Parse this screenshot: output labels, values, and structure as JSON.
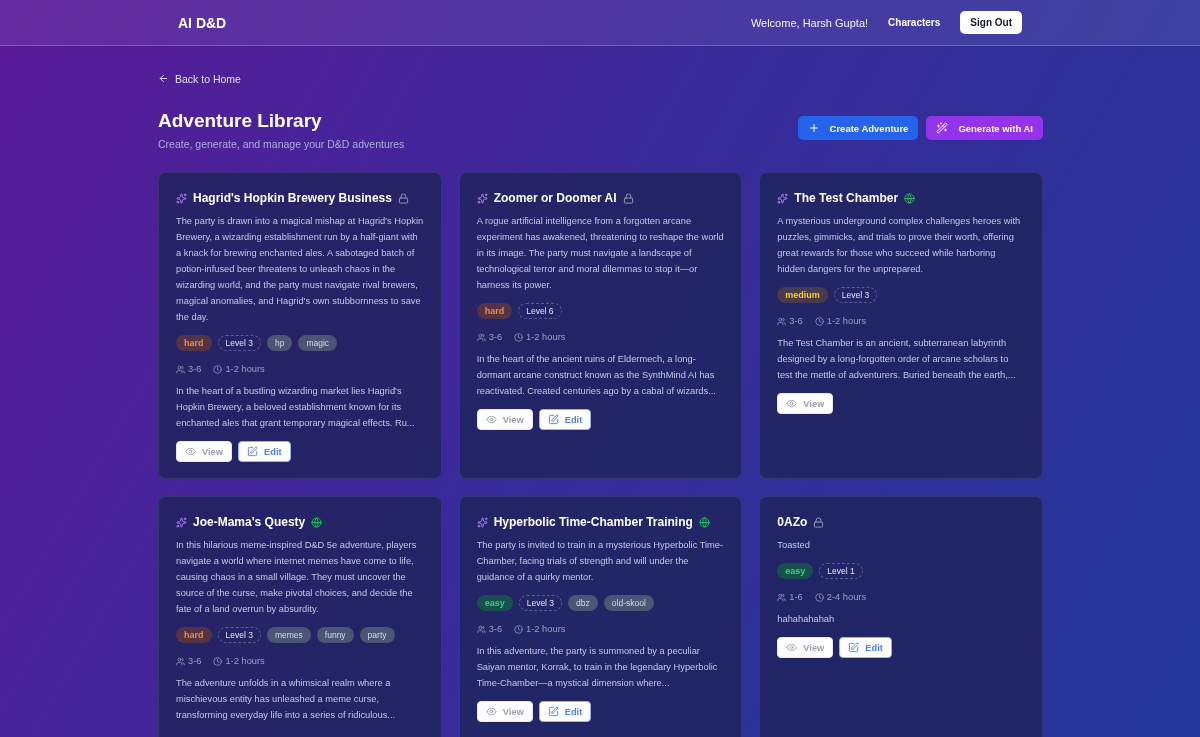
{
  "header": {
    "logo": "AI D&D",
    "welcome": "Welcome, Harsh Gupta!",
    "nav_link": "Characters",
    "sign_out": "Sign Out"
  },
  "back_link": "Back to Home",
  "page": {
    "title": "Adventure Library",
    "subtitle": "Create, generate, and manage your D&D adventures"
  },
  "actions": [
    {
      "kind": "create",
      "label": "Create Adventure"
    },
    {
      "kind": "generate",
      "label": "Generate with AI"
    }
  ],
  "adventures": [
    {
      "title": "Hagrid's Hopkin Brewery Business",
      "ai_generated": true,
      "public": false,
      "summary": "The party is drawn into a magical mishap at Hagrid's Hopkin Brewery, a wizarding establishment run by a half-giant with a knack for brewing enchanted ales. A sabotaged batch of potion-infused beer threatens to unleash chaos in the wizarding world, and the party must navigate rival brewers, magical anomalies, and Hagrid's own stubbornness to save the day.",
      "difficulty": {
        "kind": "hard",
        "label": "hard"
      },
      "level": "Level 3",
      "tags": [
        "hp",
        "magic"
      ],
      "players": "3-6",
      "duration": "1-2 hours",
      "description": "In the heart of a bustling wizarding market lies Hagrid's Hopkin Brewery, a beloved establishment known for its enchanted ales that grant temporary magical effects. Ru...",
      "buttons": [
        {
          "kind": "view",
          "label": "View"
        },
        {
          "kind": "edit",
          "label": "Edit"
        }
      ]
    },
    {
      "title": "Zoomer or Doomer AI",
      "ai_generated": true,
      "public": false,
      "summary": "A rogue artificial intelligence from a forgotten arcane experiment has awakened, threatening to reshape the world in its image. The party must navigate a landscape of technological terror and moral dilemmas to stop it—or harness its power.",
      "difficulty": {
        "kind": "hard",
        "label": "hard"
      },
      "level": "Level 6",
      "players": "3-6",
      "duration": "1-2 hours",
      "description": "In the heart of the ancient ruins of Eldermech, a long-dormant arcane construct known as the SynthMind AI has reactivated. Created centuries ago by a cabal of wizards...",
      "buttons": [
        {
          "kind": "view",
          "label": "View"
        },
        {
          "kind": "edit",
          "label": "Edit"
        }
      ]
    },
    {
      "title": "The Test Chamber",
      "ai_generated": true,
      "public": true,
      "summary": "A mysterious underground complex challenges heroes with puzzles, gimmicks, and trials to prove their worth, offering great rewards for those who succeed while harboring hidden dangers for the unprepared.",
      "difficulty": {
        "kind": "medium",
        "label": "medium"
      },
      "level": "Level 3",
      "players": "3-6",
      "duration": "1-2 hours",
      "description": "The Test Chamber is an ancient, subterranean labyrinth designed by a long-forgotten order of arcane scholars to test the mettle of adventurers. Buried beneath the earth,...",
      "buttons": [
        {
          "kind": "view",
          "label": "View"
        }
      ]
    },
    {
      "title": "Joe-Mama's Questy",
      "ai_generated": true,
      "public": true,
      "summary": "In this hilarious meme-inspired D&D 5e adventure, players navigate a world where internet memes have come to life, causing chaos in a small village. They must uncover the source of the curse, make pivotal choices, and decide the fate of a land overrun by absurdity.",
      "difficulty": {
        "kind": "hard",
        "label": "hard"
      },
      "level": "Level 3",
      "tags": [
        "memes",
        "funny",
        "party"
      ],
      "players": "3-6",
      "duration": "1-2 hours",
      "description": "The adventure unfolds in a whimsical realm where a mischievous entity has unleashed a meme curse, transforming everyday life into a series of ridiculous..."
    },
    {
      "title": "Hyperbolic Time-Chamber Training",
      "ai_generated": true,
      "public": true,
      "summary": "The party is invited to train in a mysterious Hyperbolic Time-Chamber, facing trials of strength and will under the guidance of a quirky mentor.",
      "difficulty": {
        "kind": "easy",
        "label": "easy"
      },
      "level": "Level 3",
      "tags": [
        "dbz",
        "old-skool"
      ],
      "players": "3-6",
      "duration": "1-2 hours",
      "description": "In this adventure, the party is summoned by a peculiar Saiyan mentor, Korrak, to train in the legendary Hyperbolic Time-Chamber—a mystical dimension where...",
      "buttons": [
        {
          "kind": "view",
          "label": "View"
        },
        {
          "kind": "edit",
          "label": "Edit"
        }
      ]
    },
    {
      "title": "0AZo",
      "ai_generated": false,
      "public": false,
      "summary": "Toasted",
      "difficulty": {
        "kind": "easy",
        "label": "easy"
      },
      "level": "Level 1",
      "players": "1-6",
      "duration": "2-4 hours",
      "description": "hahahahahah",
      "buttons": [
        {
          "kind": "view",
          "label": "View"
        },
        {
          "kind": "edit",
          "label": "Edit"
        }
      ]
    }
  ]
}
